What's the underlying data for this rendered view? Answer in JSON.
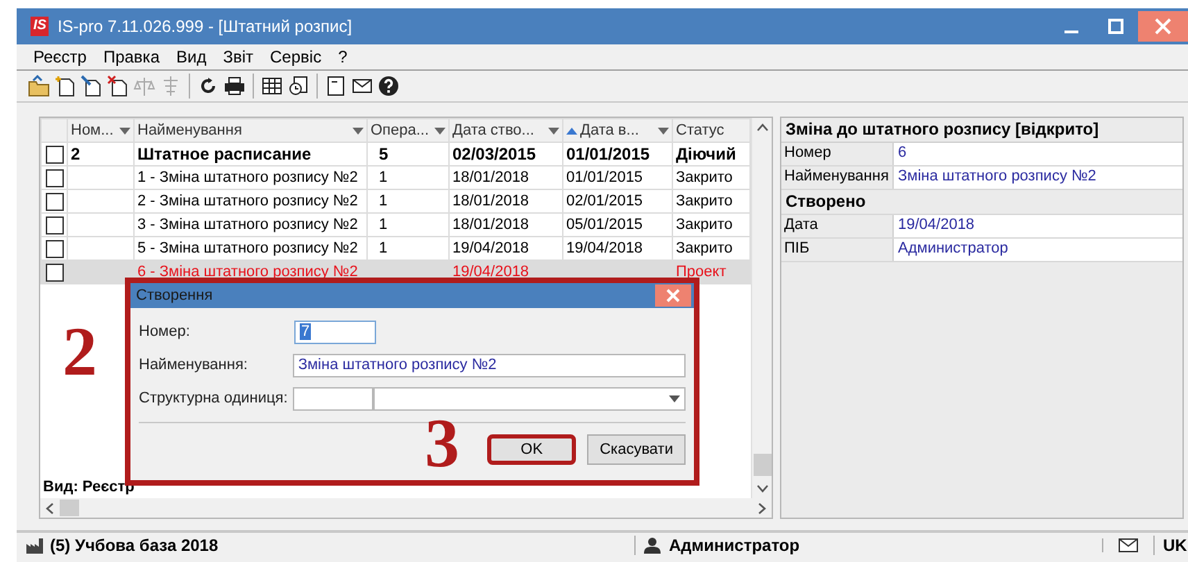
{
  "window": {
    "title": "IS-pro 7.11.026.999 - [Штатний розпис]",
    "logo": "IS"
  },
  "menu": [
    "Реєстр",
    "Правка",
    "Вид",
    "Звіт",
    "Сервіс",
    "?"
  ],
  "grid": {
    "columns": [
      {
        "label": "Ном...",
        "sorted": false
      },
      {
        "label": "Найменування",
        "sorted": false
      },
      {
        "label": "Опера...",
        "sorted": false
      },
      {
        "label": "Дата ство...",
        "sorted": false
      },
      {
        "label": "Дата в...",
        "sorted": true
      },
      {
        "label": "Статус",
        "sorted": false
      }
    ],
    "rows": [
      {
        "kind": "group",
        "checked": false,
        "selected": false,
        "cells": [
          "2",
          "Штатное расписание",
          "5",
          "02/03/2015",
          "01/01/2015",
          "Діючий"
        ]
      },
      {
        "kind": "item",
        "checked": false,
        "selected": false,
        "cells": [
          "",
          "1 - Зміна штатного розпису №2",
          "1",
          "18/01/2018",
          "01/01/2015",
          "Закрито"
        ]
      },
      {
        "kind": "item",
        "checked": false,
        "selected": false,
        "cells": [
          "",
          "2 - Зміна штатного розпису №2",
          "1",
          "18/01/2018",
          "02/01/2015",
          "Закрито"
        ]
      },
      {
        "kind": "item",
        "checked": false,
        "selected": false,
        "cells": [
          "",
          "3 - Зміна штатного розпису №2",
          "1",
          "18/01/2018",
          "05/01/2015",
          "Закрито"
        ]
      },
      {
        "kind": "item",
        "checked": false,
        "selected": false,
        "cells": [
          "",
          "5 - Зміна штатного розпису №2",
          "1",
          "19/04/2018",
          "19/04/2018",
          "Закрито"
        ]
      },
      {
        "kind": "draft",
        "checked": false,
        "selected": true,
        "cells": [
          "",
          "6 - Зміна штатного розпису №2",
          "",
          "19/04/2018",
          "",
          "Проект"
        ]
      }
    ],
    "footer": "Вид: Реєстр"
  },
  "details": {
    "title": "Зміна до штатного розпису [відкрито]",
    "rows": [
      {
        "kind": "field",
        "label": "Номер",
        "value": "6"
      },
      {
        "kind": "field",
        "label": "Найменування",
        "value": "Зміна штатного розпису №2"
      },
      {
        "kind": "section",
        "label": "Створено"
      },
      {
        "kind": "field",
        "label": "Дата",
        "value": "19/04/2018"
      },
      {
        "kind": "field",
        "label": "ПІБ",
        "value": "Администратор"
      }
    ]
  },
  "dialog": {
    "title": "Створення",
    "fields": [
      {
        "kind": "short",
        "label": "Номер:",
        "value": "7"
      },
      {
        "kind": "wide",
        "label": "Найменування:",
        "value": "Зміна штатного розпису №2"
      },
      {
        "kind": "lookup",
        "label": "Структурна одиниця:"
      }
    ],
    "buttons": [
      {
        "label": "OK",
        "highlighted": true
      },
      {
        "label": "Скасувати",
        "highlighted": false
      }
    ]
  },
  "annotations": [
    {
      "text": "2"
    },
    {
      "text": "3"
    }
  ],
  "status_bar": {
    "database": "(5) Учбова база 2018",
    "user": "Администратор",
    "language": "UK"
  }
}
